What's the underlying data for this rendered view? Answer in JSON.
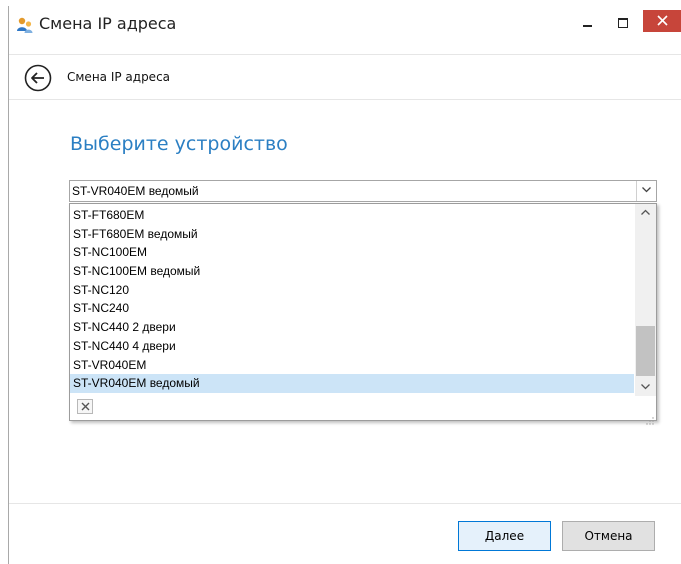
{
  "window": {
    "title": "Смена IP адреса"
  },
  "nav": {
    "title": "Смена IP адреса"
  },
  "main": {
    "heading": "Выберите устройство",
    "combo_value": "ST-VR040EM ведомый",
    "options": [
      "ST-FT680EM",
      "ST-FT680EM ведомый",
      "ST-NC100EM",
      "ST-NC100EM ведомый",
      "ST-NC120",
      "ST-NC240",
      "ST-NC440 2 двери",
      "ST-NC440 4 двери",
      "ST-VR040EM",
      "ST-VR040EM ведомый"
    ],
    "selected_option": "ST-VR040EM ведомый"
  },
  "footer": {
    "next_label": "Далее",
    "cancel_label": "Отмена"
  },
  "colors": {
    "accent": "#2b7fc3",
    "close_button": "#c7453a",
    "selection": "#cce4f7"
  },
  "icons": {
    "app": "users-icon",
    "back": "back-arrow-icon",
    "combo": "chevron-down-icon",
    "clear": "close-icon"
  }
}
